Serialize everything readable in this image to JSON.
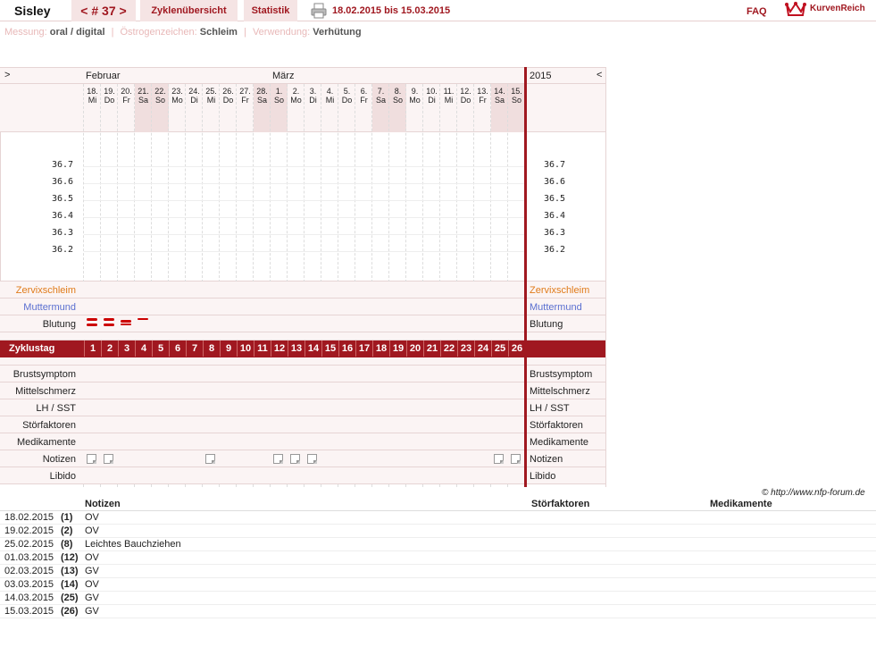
{
  "header": {
    "user": "Sisley",
    "cycle_prev": "<",
    "cycle_label": "# 37",
    "cycle_next": ">",
    "tab_overview": "Zyklenübersicht",
    "tab_stats": "Statistik",
    "date_range": "18.02.2015 bis 15.03.2015",
    "faq": "FAQ",
    "logo": "KurvenReich"
  },
  "info": {
    "measure_label": "Messung:",
    "measure_value": "oral / digital",
    "estrogen_label": "Östrogenzeichen:",
    "estrogen_value": "Schleim",
    "usage_label": "Verwendung:",
    "usage_value": "Verhütung",
    "separator": "|"
  },
  "chart": {
    "left_arrow": ">",
    "right_arrow": "<",
    "year": "2015",
    "month_feb": "Februar",
    "month_mar": "März",
    "days": [
      {
        "d": "18.",
        "w": "Mi",
        "we": false
      },
      {
        "d": "19.",
        "w": "Do",
        "we": false
      },
      {
        "d": "20.",
        "w": "Fr",
        "we": false
      },
      {
        "d": "21.",
        "w": "Sa",
        "we": true
      },
      {
        "d": "22.",
        "w": "So",
        "we": true
      },
      {
        "d": "23.",
        "w": "Mo",
        "we": false
      },
      {
        "d": "24.",
        "w": "Di",
        "we": false
      },
      {
        "d": "25.",
        "w": "Mi",
        "we": false
      },
      {
        "d": "26.",
        "w": "Do",
        "we": false
      },
      {
        "d": "27.",
        "w": "Fr",
        "we": false
      },
      {
        "d": "28.",
        "w": "Sa",
        "we": true
      },
      {
        "d": "1.",
        "w": "So",
        "we": true
      },
      {
        "d": "2.",
        "w": "Mo",
        "we": false
      },
      {
        "d": "3.",
        "w": "Di",
        "we": false
      },
      {
        "d": "4.",
        "w": "Mi",
        "we": false
      },
      {
        "d": "5.",
        "w": "Do",
        "we": false
      },
      {
        "d": "6.",
        "w": "Fr",
        "we": false
      },
      {
        "d": "7.",
        "w": "Sa",
        "we": true
      },
      {
        "d": "8.",
        "w": "So",
        "we": true
      },
      {
        "d": "9.",
        "w": "Mo",
        "we": false
      },
      {
        "d": "10.",
        "w": "Di",
        "we": false
      },
      {
        "d": "11.",
        "w": "Mi",
        "we": false
      },
      {
        "d": "12.",
        "w": "Do",
        "we": false
      },
      {
        "d": "13.",
        "w": "Fr",
        "we": false
      },
      {
        "d": "14.",
        "w": "Sa",
        "we": true
      },
      {
        "d": "15.",
        "w": "So",
        "we": true
      }
    ],
    "temps": [
      "36.7",
      "36.6",
      "36.5",
      "36.4",
      "36.3",
      "36.2"
    ],
    "rows_top": {
      "cervix": "Zervixschleim",
      "os": "Muttermund",
      "bleeding": "Blutung"
    },
    "cycle_label": "Zyklustag",
    "cycle_days": [
      "1",
      "2",
      "3",
      "4",
      "5",
      "6",
      "7",
      "8",
      "9",
      "10",
      "11",
      "12",
      "13",
      "14",
      "15",
      "16",
      "17",
      "18",
      "19",
      "20",
      "21",
      "22",
      "23",
      "24",
      "25",
      "26"
    ],
    "rows_bottom": [
      "Brustsymptom",
      "Mittelschmerz",
      "LH / SST",
      "Störfaktoren",
      "Medikamente",
      "Notizen",
      "Libido"
    ],
    "bleeding": [
      2,
      2,
      1,
      0.5
    ],
    "notes_days": [
      1,
      2,
      8,
      12,
      13,
      14,
      25,
      26
    ],
    "colors": {
      "accent": "#a01820",
      "cervix": "#e07b1a",
      "os": "#5a6fd0"
    }
  },
  "copyright": "© http://www.nfp-forum.de",
  "table": {
    "headers": [
      "Notizen",
      "Störfaktoren",
      "Medikamente"
    ],
    "rows": [
      {
        "date": "18.02.2015",
        "day": "(1)",
        "note": "OV"
      },
      {
        "date": "19.02.2015",
        "day": "(2)",
        "note": "OV"
      },
      {
        "date": "25.02.2015",
        "day": "(8)",
        "note": "Leichtes Bauchziehen"
      },
      {
        "date": "01.03.2015",
        "day": "(12)",
        "note": "OV"
      },
      {
        "date": "02.03.2015",
        "day": "(13)",
        "note": "GV"
      },
      {
        "date": "03.03.2015",
        "day": "(14)",
        "note": "OV"
      },
      {
        "date": "14.03.2015",
        "day": "(25)",
        "note": "GV"
      },
      {
        "date": "15.03.2015",
        "day": "(26)",
        "note": "GV"
      }
    ]
  }
}
